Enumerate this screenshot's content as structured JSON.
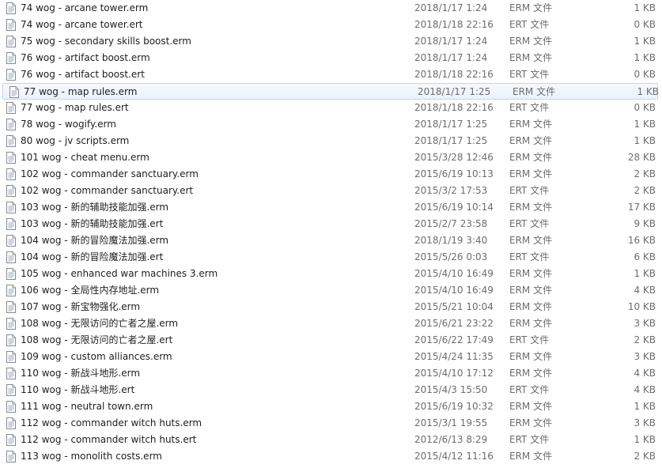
{
  "files": [
    {
      "name": "74 wog - arcane tower.erm",
      "date": "2018/1/17 1:24",
      "type": "ERM 文件",
      "size": "1 KB"
    },
    {
      "name": "74 wog - arcane tower.ert",
      "date": "2018/1/18 22:16",
      "type": "ERT 文件",
      "size": "0 KB"
    },
    {
      "name": "75 wog - secondary skills boost.erm",
      "date": "2018/1/17 1:24",
      "type": "ERM 文件",
      "size": "1 KB"
    },
    {
      "name": "76 wog - artifact boost.erm",
      "date": "2018/1/17 1:24",
      "type": "ERM 文件",
      "size": "1 KB"
    },
    {
      "name": "76 wog - artifact boost.ert",
      "date": "2018/1/18 22:16",
      "type": "ERT 文件",
      "size": "0 KB"
    },
    {
      "name": "77 wog - map rules.erm",
      "date": "2018/1/17 1:25",
      "type": "ERM 文件",
      "size": "1 KB",
      "selected": true
    },
    {
      "name": "77 wog - map rules.ert",
      "date": "2018/1/18 22:16",
      "type": "ERT 文件",
      "size": "0 KB"
    },
    {
      "name": "78 wog - wogify.erm",
      "date": "2018/1/17 1:25",
      "type": "ERM 文件",
      "size": "1 KB"
    },
    {
      "name": "80 wog - jv scripts.erm",
      "date": "2018/1/17 1:25",
      "type": "ERM 文件",
      "size": "1 KB"
    },
    {
      "name": "101 wog - cheat menu.erm",
      "date": "2015/3/28 12:46",
      "type": "ERM 文件",
      "size": "28 KB"
    },
    {
      "name": "102 wog - commander sanctuary.erm",
      "date": "2015/6/19 10:13",
      "type": "ERM 文件",
      "size": "2 KB"
    },
    {
      "name": "102 wog - commander sanctuary.ert",
      "date": "2015/3/2 17:53",
      "type": "ERT 文件",
      "size": "2 KB"
    },
    {
      "name": "103 wog - 新的辅助技能加强.erm",
      "date": "2015/6/19 10:14",
      "type": "ERM 文件",
      "size": "17 KB"
    },
    {
      "name": "103 wog - 新的辅助技能加强.ert",
      "date": "2015/2/7 23:58",
      "type": "ERT 文件",
      "size": "9 KB"
    },
    {
      "name": "104 wog - 新的冒险魔法加强.erm",
      "date": "2018/1/19 3:40",
      "type": "ERM 文件",
      "size": "16 KB"
    },
    {
      "name": "104 wog - 新的冒险魔法加强.ert",
      "date": "2015/5/26 0:03",
      "type": "ERT 文件",
      "size": "6 KB"
    },
    {
      "name": "105 wog - enhanced war machines 3.erm",
      "date": "2015/4/10 16:49",
      "type": "ERM 文件",
      "size": "1 KB"
    },
    {
      "name": "106 wog - 全局性内存地址.erm",
      "date": "2015/4/10 16:49",
      "type": "ERM 文件",
      "size": "4 KB"
    },
    {
      "name": "107 wog - 新宝物强化.erm",
      "date": "2015/5/21 10:04",
      "type": "ERM 文件",
      "size": "10 KB"
    },
    {
      "name": "108 wog - 无限访问的亡者之屋.erm",
      "date": "2015/6/21 23:22",
      "type": "ERM 文件",
      "size": "3 KB"
    },
    {
      "name": "108 wog - 无限访问的亡者之屋.ert",
      "date": "2015/6/22 17:49",
      "type": "ERT 文件",
      "size": "2 KB"
    },
    {
      "name": "109 wog - custom alliances.erm",
      "date": "2015/4/24 11:35",
      "type": "ERM 文件",
      "size": "3 KB"
    },
    {
      "name": "110 wog - 新战斗地形.erm",
      "date": "2015/4/10 17:12",
      "type": "ERM 文件",
      "size": "4 KB"
    },
    {
      "name": "110 wog - 新战斗地形.ert",
      "date": "2015/4/3 15:50",
      "type": "ERT 文件",
      "size": "4 KB"
    },
    {
      "name": "111 wog - neutral town.erm",
      "date": "2015/6/19 10:32",
      "type": "ERM 文件",
      "size": "1 KB"
    },
    {
      "name": "112 wog - commander witch huts.erm",
      "date": "2015/3/1 19:55",
      "type": "ERM 文件",
      "size": "3 KB"
    },
    {
      "name": "112 wog - commander witch huts.ert",
      "date": "2012/6/13 8:29",
      "type": "ERT 文件",
      "size": "1 KB"
    },
    {
      "name": "113 wog - monolith costs.erm",
      "date": "2015/4/12 11:16",
      "type": "ERM 文件",
      "size": "2 KB"
    }
  ],
  "icon": "document-icon"
}
